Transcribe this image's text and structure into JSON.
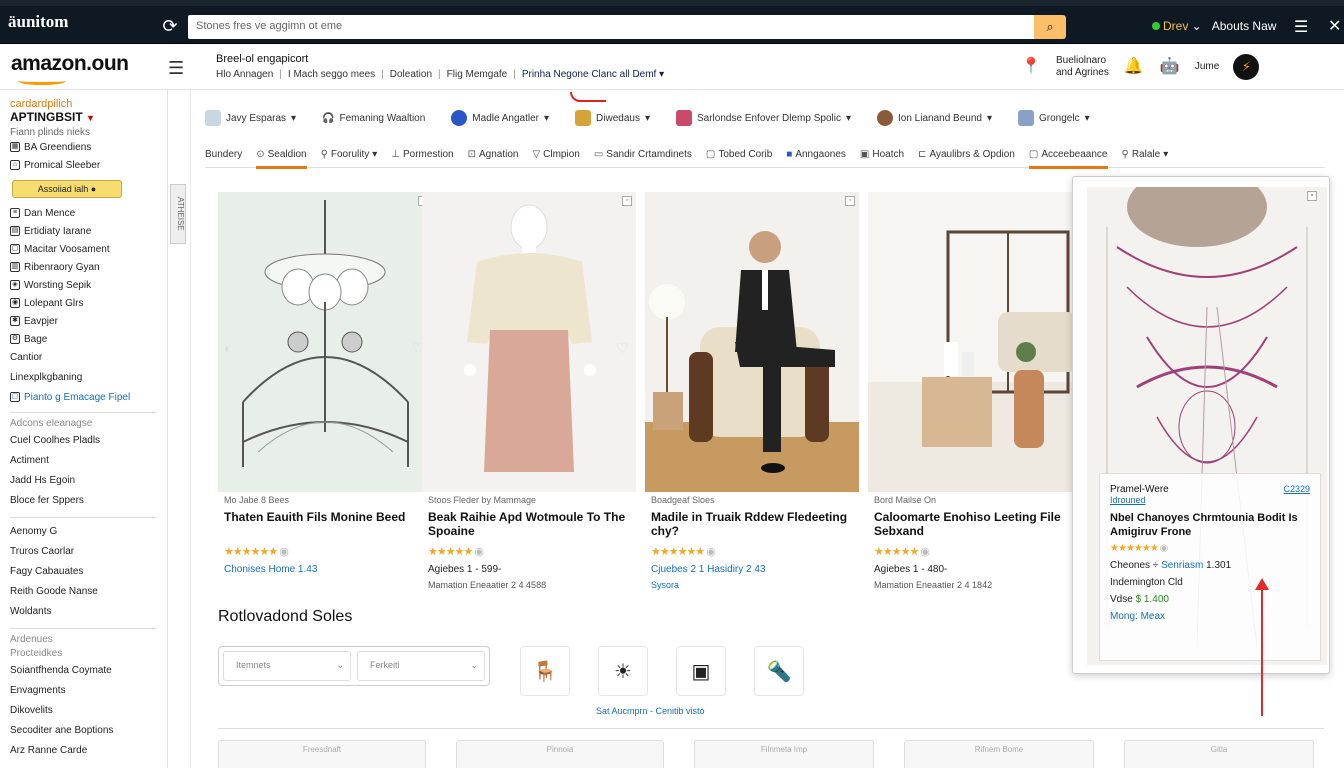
{
  "chrome": {
    "brand": "unitom",
    "url_text": "Stones fres ve aggimn ot eme",
    "status": "Drev",
    "account": "Abouts Naw"
  },
  "header": {
    "logo": "amazon.oun",
    "title": "Breel-ol engapicort",
    "crumbs": [
      "Hlo Annagen",
      "I Mach seggo mees",
      "Doleation",
      "Flig Memgafe",
      "Prinha Negone Clanc all Demf"
    ],
    "user_line1": "Bueliolnaro",
    "user_line2": "and Agrines",
    "user_name": "Jume"
  },
  "sidebar": {
    "brand_line": "cardardpilich",
    "brand_main": "APTINGBSIT",
    "sub": "Fiann plinds nieks",
    "items_a": [
      "BA Greendiens",
      "Promical Sleeber"
    ],
    "button": "Assoiiad ialh",
    "items_b": [
      "Dan Mence",
      "Ertidiaty Iarane",
      "Macitar Voosament",
      "Ribenraory Gyan",
      "Worsting Sepik",
      "Lolepant Glrs",
      "Eavpjer",
      "Bage"
    ],
    "plain_a": [
      "Cantior",
      "Linexplkgbaning"
    ],
    "link": "Pianto g Emacage Fipel",
    "head_a": "Adcons eleanagse",
    "plain_b": [
      "Cuel Coolhes Pladls",
      "Actiment",
      "Jadd Hs Egoin",
      "Bloce fer Sppers"
    ],
    "plain_c": [
      "Aenomy G",
      "Truros Caorlar",
      "Fagy Cabauates",
      "Reith Goode Nanse",
      "Woldants"
    ],
    "head_b": "Ardenues",
    "head_c": "Procteidkes",
    "plain_d": [
      "Soiantfhenda Coymate",
      "Envagments",
      "Dikovelits",
      "Secoditer ane Boptions",
      "Arz Ranne Carde"
    ],
    "toggle": "ATHEISE"
  },
  "filters": [
    {
      "label": "Javy Esparas",
      "color": "#c9d6e3"
    },
    {
      "label": "Femaning Waaltion",
      "color": "#ffffff"
    },
    {
      "label": "Madle Angatler",
      "color": "#2b56c8"
    },
    {
      "label": "Diwedaus",
      "color": "#d4a43a"
    },
    {
      "label": "Sarlondse Enfover Dlemp Spolic",
      "color": "#c94a6a"
    },
    {
      "label": "Ion Lianand Beund",
      "color": "#8a5a3a"
    },
    {
      "label": "Grongelc",
      "color": "#8aa0c8"
    }
  ],
  "tabs": [
    "Bundery",
    "Sealdion",
    "Foorulity",
    "Pormestion",
    "Agnation",
    "Clmpion",
    "Sandir Crtamdinets",
    "Tobed Corib",
    "Anngaones",
    "Hoatch",
    "Ayaulibrs & Opdion",
    "Acceebeaance",
    "Ralale"
  ],
  "products": [
    {
      "seller": "Mo Jabe 8 Bees",
      "title": "Thaten Eauith Fils Monine Beed",
      "price": "Chonises Home 1.43",
      "meta": ""
    },
    {
      "seller": "Stoos Fleder by Mammage",
      "title": "Beak Raihie Apd Wotmoule To The Spoaine",
      "price": "Agiebes 1 - 599-",
      "meta": "Mamation Eneaatier 2 4 4588"
    },
    {
      "seller": "Boadgeaf Sloes",
      "title": "Madile in Truaik Rddew Fledeeting chy?",
      "price": "Cjuebes 2 1 Hasidiry 2 43",
      "meta": "Sysora"
    },
    {
      "seller": "Bord Mailse On",
      "title": "Caloomarte Enohiso Leeting File Sebxand",
      "price": "Agiebes 1 - 480-",
      "meta": "Mamation Eneaatier 2 4 1842"
    }
  ],
  "popup": {
    "label": "Pramel-Were",
    "tag": "Idrouned",
    "badge": "C2329",
    "title": "Nbel Chanoyes Chrmtounia Bodit Is Amigiruv Frone",
    "line1_a": "Cheones",
    "line1_b": "Senriasm",
    "line1_c": "1.301",
    "line2": "Indemington Cld",
    "line3_a": "Vdse",
    "line3_b": "$ 1.400",
    "link": "Mong: Meax"
  },
  "recommended": {
    "title": "Rotlovadond Soles",
    "input1": "Itemnets",
    "input2": "Ferkeiti",
    "link": "Sat Aucmprn - Cenitib visto",
    "bottom_boxes": [
      "Freesdnaft",
      "Pinnoia",
      "Filnmeta Imp",
      "Rifnem Bome",
      "Gitla"
    ]
  }
}
